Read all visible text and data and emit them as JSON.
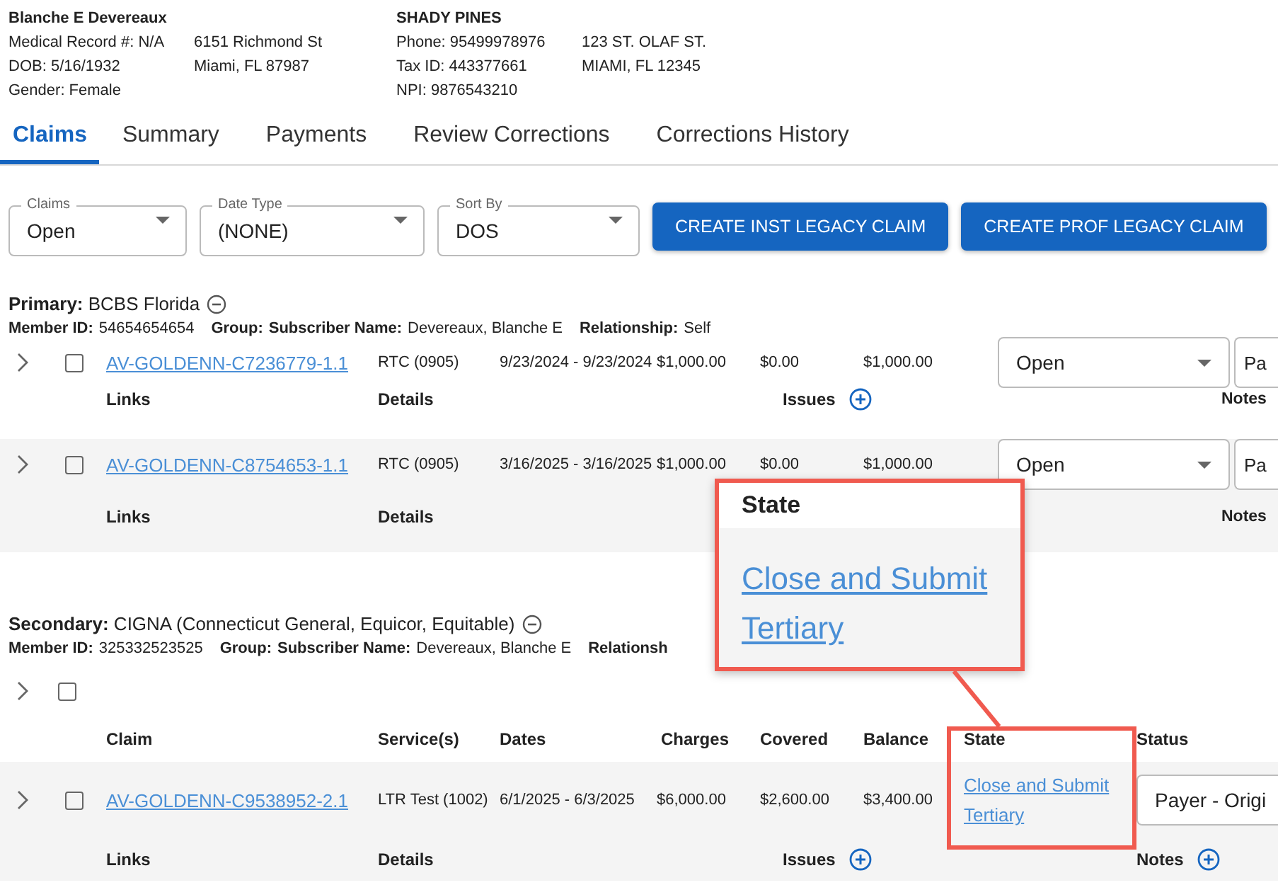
{
  "patient": {
    "name": "Blanche E Devereaux",
    "details": [
      "Medical Record #: N/A",
      "DOB: 5/16/1932",
      "Gender: Female"
    ],
    "address": [
      "6151 Richmond St",
      "Miami, FL 87987"
    ]
  },
  "facility": {
    "name": "SHADY PINES",
    "details": [
      "Phone: 95499978976",
      "Tax ID: 443377661",
      "NPI: 9876543210"
    ],
    "address": [
      "123 ST. OLAF ST.",
      "MIAMI, FL 12345"
    ]
  },
  "tabs": [
    {
      "label": "Claims",
      "selected": true
    },
    {
      "label": "Summary",
      "selected": false
    },
    {
      "label": "Payments",
      "selected": false
    },
    {
      "label": "Review Corrections",
      "selected": false
    },
    {
      "label": "Corrections History",
      "selected": false
    }
  ],
  "filters": [
    {
      "label": "Claims",
      "value": "Open"
    },
    {
      "label": "Date Type",
      "value": "(NONE)"
    },
    {
      "label": "Sort By",
      "value": "DOS"
    }
  ],
  "buttons": [
    "CREATE INST LEGACY CLAIM",
    "CREATE PROF LEGACY CLAIM"
  ],
  "primary": {
    "heading": "Primary:",
    "payer": "BCBS Florida",
    "member": [
      {
        "label": "Member ID:",
        "value": "54654654654"
      },
      {
        "label": "Group:"
      },
      {
        "label": "Subscriber Name:",
        "value": "Devereaux, Blanche E"
      },
      {
        "label": "Relationship:",
        "value": "Self"
      }
    ],
    "rows": [
      {
        "checked": false,
        "claim": "AV-GOLDENN-C7236779-1.1",
        "service": "RTC (0905)",
        "dates": "9/23/2024 - 9/23/2024",
        "charges": "$1,000.00",
        "covered": "$0.00",
        "balance": "$1,000.00",
        "status": "Open",
        "status_2": "Pa",
        "links": "Links",
        "details": "Details",
        "issues": "Issues",
        "notes": "Notes"
      },
      {
        "checked": false,
        "claim": "AV-GOLDENN-C8754653-1.1",
        "service": "RTC (0905)",
        "dates": "3/16/2025 - 3/16/2025",
        "charges": "$1,000.00",
        "covered": "$0.00",
        "balance": "$1,000.00",
        "status": "Open",
        "status_2": "Pa",
        "links": "Links",
        "details": "Details",
        "notes": "Notes"
      }
    ]
  },
  "secondary": {
    "heading": "Secondary:",
    "payer": "CIGNA (Connecticut General, Equicor, Equitable)",
    "member": [
      {
        "label": "Member ID:",
        "value": "325332523525"
      },
      {
        "label": "Group:"
      },
      {
        "label": "Subscriber Name:",
        "value": "Devereaux, Blanche E"
      },
      {
        "label": "Relationsh"
      }
    ],
    "select_all_checked": false,
    "columns": [
      "Claim",
      "Service(s)",
      "Dates",
      "Charges",
      "Covered",
      "Balance",
      "State",
      "Status"
    ],
    "rows": [
      {
        "checked": false,
        "claim": "AV-GOLDENN-C9538952-2.1",
        "service": "LTR Test (1002)",
        "dates": "6/1/2025 - 6/3/2025",
        "charges": "$6,000.00",
        "covered": "$2,600.00",
        "balance": "$3,400.00",
        "state": "Close and Submit Tertiary",
        "status": "Payer - Origi",
        "links": "Links",
        "details": "Details",
        "issues": "Issues",
        "notes": "Notes"
      }
    ]
  },
  "callout": {
    "header": "State",
    "link": "Close and Submit Tertiary"
  }
}
